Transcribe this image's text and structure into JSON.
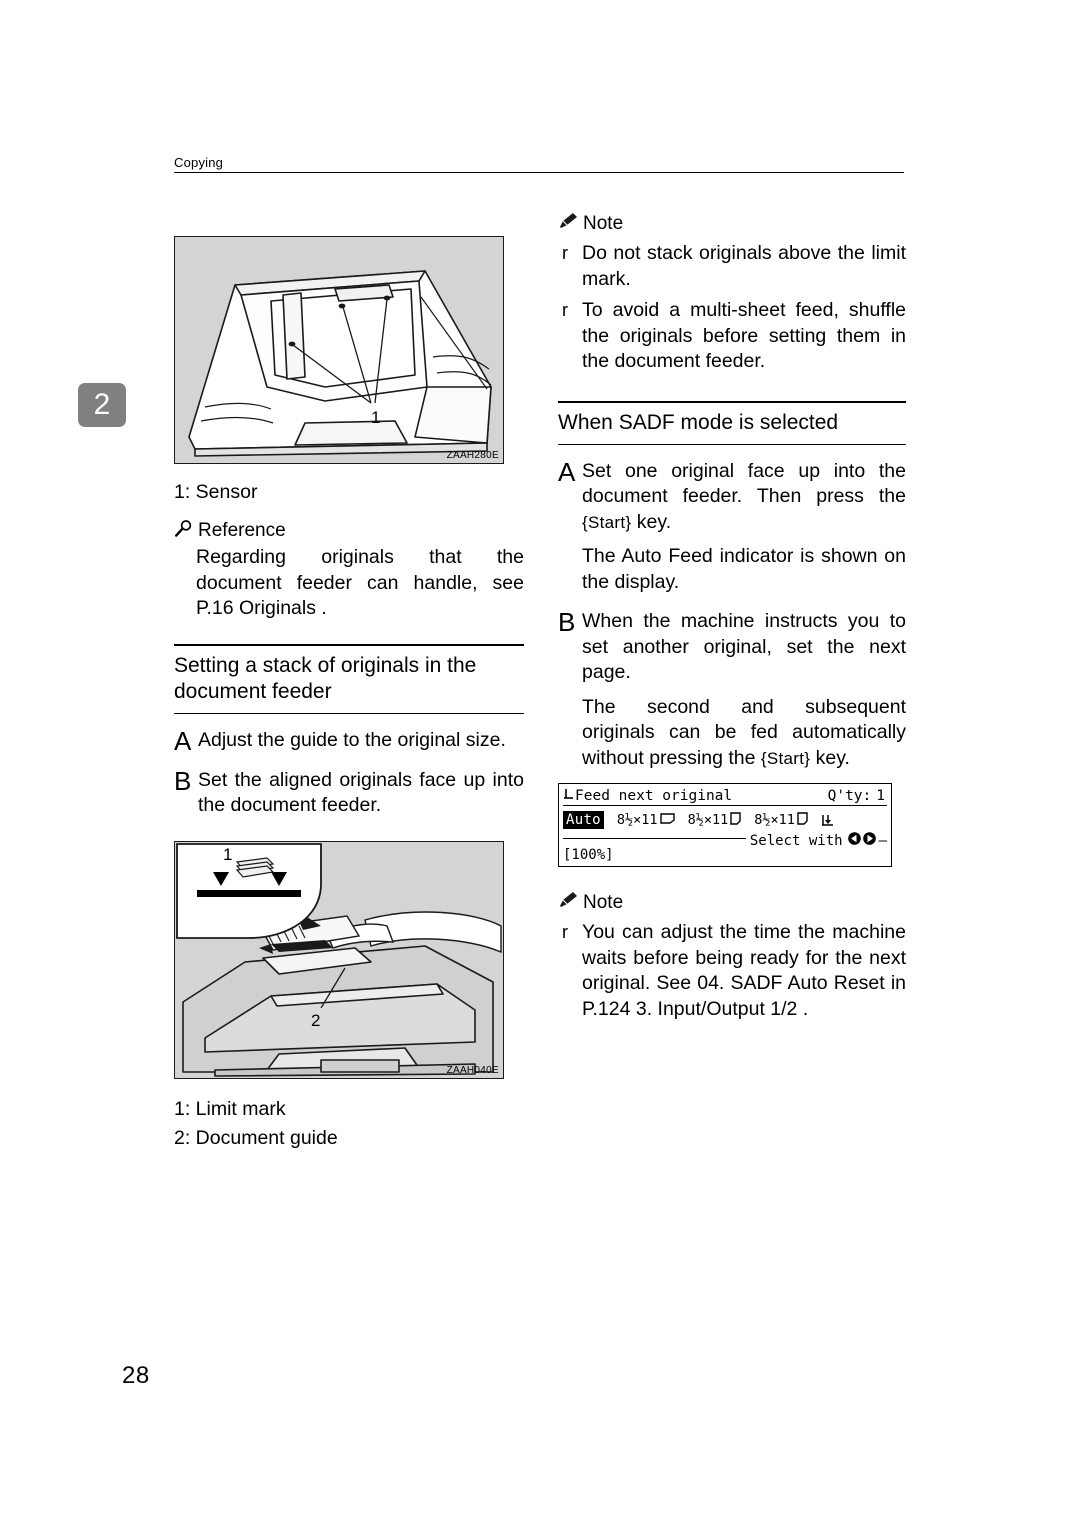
{
  "page": {
    "running_head": "Copying",
    "chapter_tab": "2",
    "page_number": "28"
  },
  "left_column": {
    "figure1": {
      "code": "ZAAH280E",
      "callout": "1"
    },
    "caption1": "1: Sensor",
    "reference": {
      "icon": "magnifier-icon",
      "label": "Reference",
      "text": "Regarding originals that the document feeder can handle, see  P.16  Originals ."
    },
    "section_heading": "Setting a stack of originals in the document feeder",
    "steps": [
      {
        "letter": "A",
        "text": "Adjust the guide to the original size."
      },
      {
        "letter": "B",
        "text": "Set the aligned originals face up into the document feeder."
      }
    ],
    "figure2": {
      "code": "ZAAH040E",
      "callout_1": "1",
      "callout_2": "2"
    },
    "caption2": "1: Limit mark",
    "caption3": "2: Document guide"
  },
  "right_column": {
    "note1": {
      "icon": "pencil-icon",
      "label": "Note",
      "bullet_mark": "r",
      "items": [
        "Do not stack originals above the limit mark.",
        "To avoid a multi-sheet feed, shuffle the originals before setting them in the document feeder."
      ]
    },
    "section_heading": "When SADF mode is selected",
    "step_a": {
      "letter": "A",
      "text_before": "Set one original face up into the document feeder. Then press the",
      "key": "Start",
      "text_after": "key.",
      "sub": "The Auto Feed indicator is shown on the display."
    },
    "step_b": {
      "letter": "B",
      "text": "When the machine instructs you to set another original, set the next page.",
      "sub_before": "The second and subsequent originals can be fed automatically without pressing the",
      "key": "Start",
      "sub_after": "key."
    },
    "lcd": {
      "title": "Feed next original",
      "quantity_label": "Q'ty:",
      "quantity_value": "1",
      "auto_chip": "Auto",
      "paper_sizes": [
        {
          "size": "8½×11",
          "orientation": "landscape-icon"
        },
        {
          "size": "8½×11",
          "orientation": "portrait-icon"
        },
        {
          "size": "8½×11",
          "orientation": "portrait-icon"
        }
      ],
      "tray_icon": "tray-icon",
      "select_hint": "Select with",
      "zoom_value": "[100%]"
    },
    "note2": {
      "icon": "pencil-icon",
      "label": "Note",
      "bullet_mark": "r",
      "items": [
        "You can adjust the time the machine waits before being ready for the next original. See  04. SADF Auto Reset  in   P.124  3. Input/Output 1/2 ."
      ]
    }
  }
}
